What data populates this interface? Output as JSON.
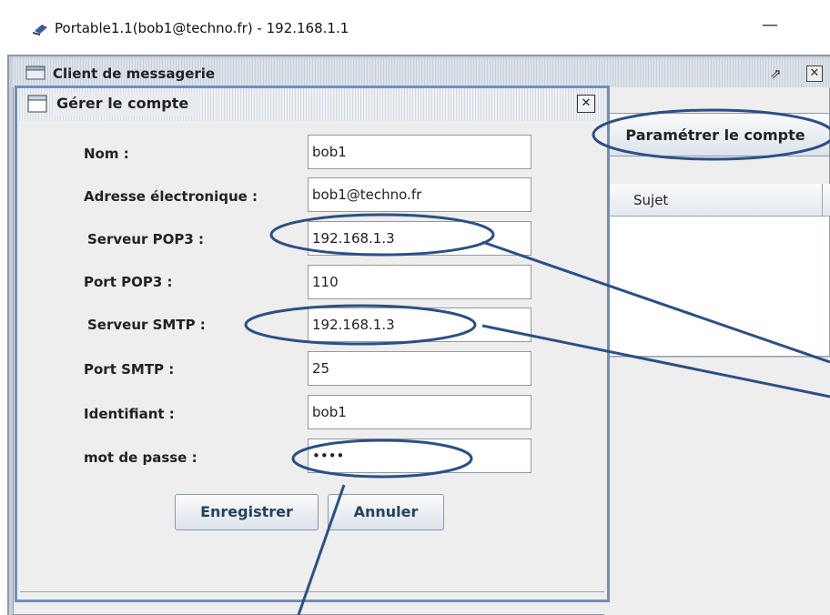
{
  "window": {
    "title": "Portable1.1(bob1@techno.fr) - 192.168.1.1",
    "minimize_glyph": "—"
  },
  "mail_frame": {
    "title": "Client de messagerie",
    "maximize_glyph": "⇗",
    "close_glyph": "✕",
    "param_button": "Paramétrer le compte",
    "table_columns": [
      "Sujet"
    ]
  },
  "dialog": {
    "title": "Gérer le compte",
    "close_glyph": "✕",
    "fields": [
      {
        "label": "Nom :",
        "value": "bob1"
      },
      {
        "label": "Adresse électronique :",
        "value": "bob1@techno.fr"
      },
      {
        "label": "Serveur POP3 :",
        "value": "192.168.1.3"
      },
      {
        "label": "Port POP3 :",
        "value": "110"
      },
      {
        "label": "Serveur SMTP :",
        "value": "192.168.1.3"
      },
      {
        "label": "Port SMTP :",
        "value": "25"
      },
      {
        "label": "Identifiant :",
        "value": "bob1"
      },
      {
        "label": "mot de passe :",
        "value": "••••"
      }
    ],
    "save_button": "Enregistrer",
    "cancel_button": "Annuler"
  },
  "colors": {
    "annotation_stroke": "#2c4f86",
    "dialog_border": "#6e8fc0"
  }
}
